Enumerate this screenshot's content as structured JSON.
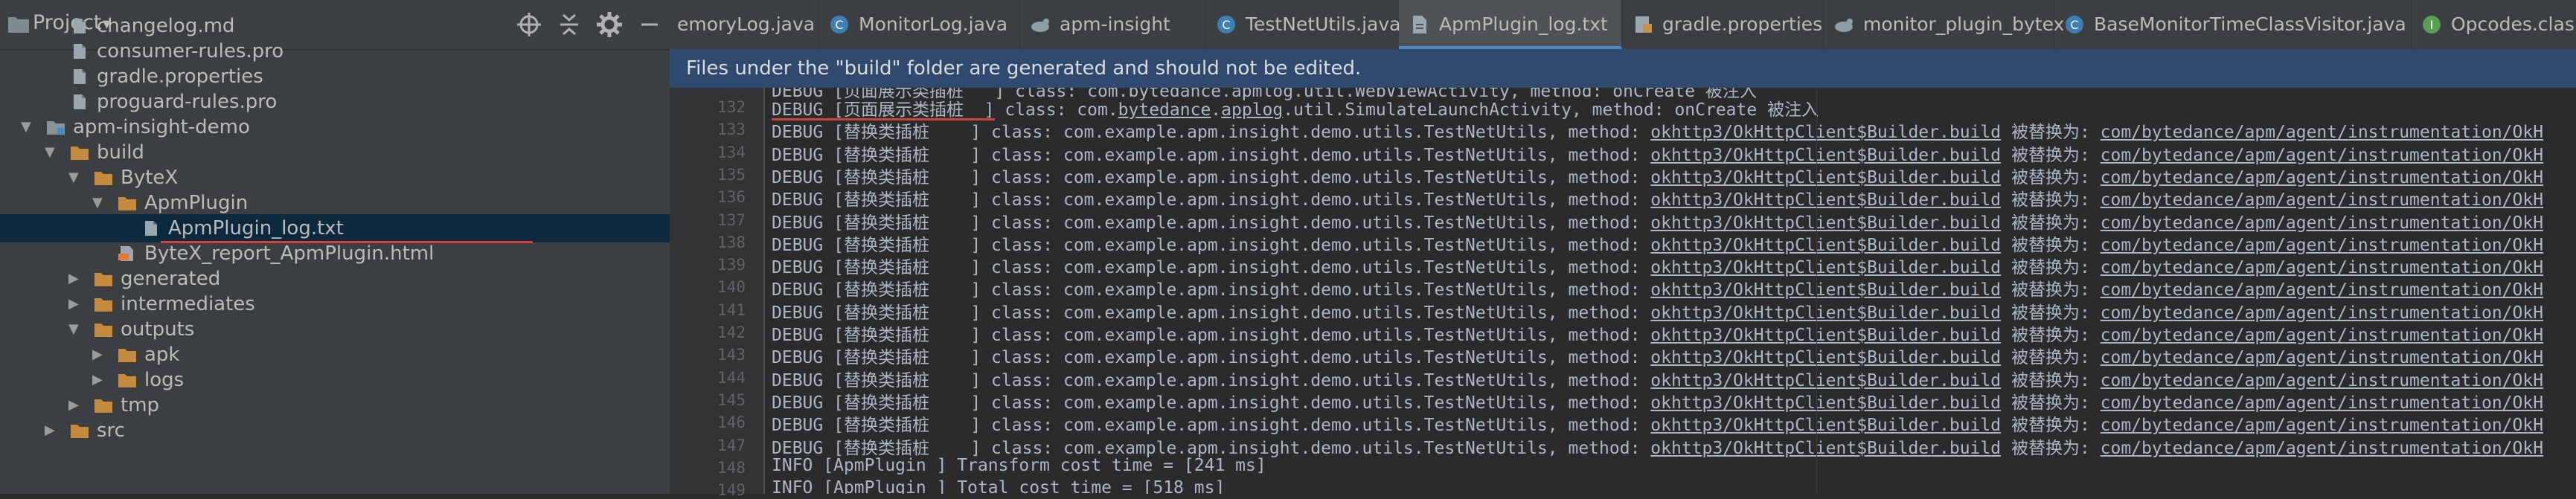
{
  "project_panel": {
    "title": "Project",
    "tree": [
      {
        "label": "changelog.md",
        "indent": 1,
        "icon": "file",
        "arrow": ""
      },
      {
        "label": "consumer-rules.pro",
        "indent": 1,
        "icon": "file",
        "arrow": ""
      },
      {
        "label": "gradle.properties",
        "indent": 1,
        "icon": "file",
        "arrow": ""
      },
      {
        "label": "proguard-rules.pro",
        "indent": 1,
        "icon": "file",
        "arrow": ""
      },
      {
        "label": "apm-insight-demo",
        "indent": 0,
        "icon": "module",
        "arrow": "down"
      },
      {
        "label": "build",
        "indent": 1,
        "icon": "folder",
        "arrow": "down"
      },
      {
        "label": "ByteX",
        "indent": 2,
        "icon": "folder",
        "arrow": "down"
      },
      {
        "label": "ApmPlugin",
        "indent": 3,
        "icon": "folder",
        "arrow": "down"
      },
      {
        "label": "ApmPlugin_log.txt",
        "indent": 4,
        "icon": "file",
        "arrow": "",
        "selected": true
      },
      {
        "label": "ByteX_report_ApmPlugin.html",
        "indent": 3,
        "icon": "html",
        "arrow": ""
      },
      {
        "label": "generated",
        "indent": 2,
        "icon": "folder",
        "arrow": "right"
      },
      {
        "label": "intermediates",
        "indent": 2,
        "icon": "folder",
        "arrow": "right"
      },
      {
        "label": "outputs",
        "indent": 2,
        "icon": "folder",
        "arrow": "down"
      },
      {
        "label": "apk",
        "indent": 3,
        "icon": "folder",
        "arrow": "right"
      },
      {
        "label": "logs",
        "indent": 3,
        "icon": "folder",
        "arrow": "right"
      },
      {
        "label": "tmp",
        "indent": 2,
        "icon": "folder",
        "arrow": "right"
      },
      {
        "label": "src",
        "indent": 1,
        "icon": "folder",
        "arrow": "right"
      }
    ]
  },
  "tabs": [
    {
      "label": "emoryLog.java",
      "icon": "",
      "active": false
    },
    {
      "label": "MonitorLog.java",
      "icon": "class",
      "active": false
    },
    {
      "label": "apm-insight",
      "icon": "gradle",
      "active": false
    },
    {
      "label": "TestNetUtils.java",
      "icon": "class",
      "active": false
    },
    {
      "label": "ApmPlugin_log.txt",
      "icon": "text",
      "active": true
    },
    {
      "label": "gradle.properties",
      "icon": "props",
      "active": false
    },
    {
      "label": "monitor_plugin_bytex",
      "icon": "gradle",
      "active": false
    },
    {
      "label": "BaseMonitorTimeClassVisitor.java",
      "icon": "class",
      "active": false
    },
    {
      "label": "Opcodes.clas",
      "icon": "interface",
      "active": false
    }
  ],
  "banner": {
    "text": "Files under the \"build\" folder are generated and should not be edited."
  },
  "editor": {
    "line_numbers": [
      "132",
      "133",
      "134",
      "135",
      "136",
      "137",
      "138",
      "139",
      "140",
      "141",
      "142",
      "143",
      "144",
      "145",
      "146",
      "147",
      "148",
      "149"
    ],
    "top_partial_line": "DEBUG [页面展示类插桩   ] class: com.bytedance.apmlog.util.WebViewActivity, method: onCreate 被注入",
    "lines": [
      {
        "level": "DEBUG",
        "tag": "[页面展示类插桩  ]",
        "p1": " class: com.",
        "u1": "bytedance",
        "p2": ".",
        "u2": "applog",
        "p3": ".util.SimulateLaunchActivity, method: onCreate 被注入",
        "u3": "",
        "p4": "",
        "u4": "",
        "p5": ""
      },
      {
        "level": "DEBUG",
        "tag": "[替换类插桩    ]",
        "p1": " class: com.example.apm.insight.demo.utils.TestNetUtils, method: ",
        "u1": "okhttp3/OkHttpClient$Builder.build",
        "p2": " 被替换为: ",
        "u2": "com/bytedance/apm/agent/instrumentation/OkH",
        "p3": "",
        "u3": "",
        "p4": "",
        "u4": "",
        "p5": ""
      },
      {
        "level": "DEBUG",
        "tag": "[替换类插桩    ]",
        "p1": " class: com.example.apm.insight.demo.utils.TestNetUtils, method: ",
        "u1": "okhttp3/OkHttpClient$Builder.build",
        "p2": " 被替换为: ",
        "u2": "com/bytedance/apm/agent/instrumentation/OkH",
        "p3": "",
        "u3": "",
        "p4": "",
        "u4": "",
        "p5": ""
      },
      {
        "level": "DEBUG",
        "tag": "[替换类插桩    ]",
        "p1": " class: com.example.apm.insight.demo.utils.TestNetUtils, method: ",
        "u1": "okhttp3/OkHttpClient$Builder.build",
        "p2": " 被替换为: ",
        "u2": "com/bytedance/apm/agent/instrumentation/OkH",
        "p3": "",
        "u3": "",
        "p4": "",
        "u4": "",
        "p5": ""
      },
      {
        "level": "DEBUG",
        "tag": "[替换类插桩    ]",
        "p1": " class: com.example.apm.insight.demo.utils.TestNetUtils, method: ",
        "u1": "okhttp3/OkHttpClient$Builder.build",
        "p2": " 被替换为: ",
        "u2": "com/bytedance/apm/agent/instrumentation/OkH",
        "p3": "",
        "u3": "",
        "p4": "",
        "u4": "",
        "p5": ""
      },
      {
        "level": "DEBUG",
        "tag": "[替换类插桩    ]",
        "p1": " class: com.example.apm.insight.demo.utils.TestNetUtils, method: ",
        "u1": "okhttp3/OkHttpClient$Builder.build",
        "p2": " 被替换为: ",
        "u2": "com/bytedance/apm/agent/instrumentation/OkH",
        "p3": "",
        "u3": "",
        "p4": "",
        "u4": "",
        "p5": ""
      },
      {
        "level": "DEBUG",
        "tag": "[替换类插桩    ]",
        "p1": " class: com.example.apm.insight.demo.utils.TestNetUtils, method: ",
        "u1": "okhttp3/OkHttpClient$Builder.build",
        "p2": " 被替换为: ",
        "u2": "com/bytedance/apm/agent/instrumentation/OkH",
        "p3": "",
        "u3": "",
        "p4": "",
        "u4": "",
        "p5": ""
      },
      {
        "level": "DEBUG",
        "tag": "[替换类插桩    ]",
        "p1": " class: com.example.apm.insight.demo.utils.TestNetUtils, method: ",
        "u1": "okhttp3/OkHttpClient$Builder.build",
        "p2": " 被替换为: ",
        "u2": "com/bytedance/apm/agent/instrumentation/OkH",
        "p3": "",
        "u3": "",
        "p4": "",
        "u4": "",
        "p5": ""
      },
      {
        "level": "DEBUG",
        "tag": "[替换类插桩    ]",
        "p1": " class: com.example.apm.insight.demo.utils.TestNetUtils, method: ",
        "u1": "okhttp3/OkHttpClient$Builder.build",
        "p2": " 被替换为: ",
        "u2": "com/bytedance/apm/agent/instrumentation/OkH",
        "p3": "",
        "u3": "",
        "p4": "",
        "u4": "",
        "p5": ""
      },
      {
        "level": "DEBUG",
        "tag": "[替换类插桩    ]",
        "p1": " class: com.example.apm.insight.demo.utils.TestNetUtils, method: ",
        "u1": "okhttp3/OkHttpClient$Builder.build",
        "p2": " 被替换为: ",
        "u2": "com/bytedance/apm/agent/instrumentation/OkH",
        "p3": "",
        "u3": "",
        "p4": "",
        "u4": "",
        "p5": ""
      },
      {
        "level": "DEBUG",
        "tag": "[替换类插桩    ]",
        "p1": " class: com.example.apm.insight.demo.utils.TestNetUtils, method: ",
        "u1": "okhttp3/OkHttpClient$Builder.build",
        "p2": " 被替换为: ",
        "u2": "com/bytedance/apm/agent/instrumentation/OkH",
        "p3": "",
        "u3": "",
        "p4": "",
        "u4": "",
        "p5": ""
      },
      {
        "level": "DEBUG",
        "tag": "[替换类插桩    ]",
        "p1": " class: com.example.apm.insight.demo.utils.TestNetUtils, method: ",
        "u1": "okhttp3/OkHttpClient$Builder.build",
        "p2": " 被替换为: ",
        "u2": "com/bytedance/apm/agent/instrumentation/OkH",
        "p3": "",
        "u3": "",
        "p4": "",
        "u4": "",
        "p5": ""
      },
      {
        "level": "DEBUG",
        "tag": "[替换类插桩    ]",
        "p1": " class: com.example.apm.insight.demo.utils.TestNetUtils, method: ",
        "u1": "okhttp3/OkHttpClient$Builder.build",
        "p2": " 被替换为: ",
        "u2": "com/bytedance/apm/agent/instrumentation/OkH",
        "p3": "",
        "u3": "",
        "p4": "",
        "u4": "",
        "p5": ""
      },
      {
        "level": "DEBUG",
        "tag": "[替换类插桩    ]",
        "p1": " class: com.example.apm.insight.demo.utils.TestNetUtils, method: ",
        "u1": "okhttp3/OkHttpClient$Builder.build",
        "p2": " 被替换为: ",
        "u2": "com/bytedance/apm/agent/instrumentation/OkH",
        "p3": "",
        "u3": "",
        "p4": "",
        "u4": "",
        "p5": ""
      },
      {
        "level": "DEBUG",
        "tag": "[替换类插桩    ]",
        "p1": " class: com.example.apm.insight.demo.utils.TestNetUtils, method: ",
        "u1": "okhttp3/OkHttpClient$Builder.build",
        "p2": " 被替换为: ",
        "u2": "com/bytedance/apm/agent/instrumentation/OkH",
        "p3": "",
        "u3": "",
        "p4": "",
        "u4": "",
        "p5": ""
      },
      {
        "level": "DEBUG",
        "tag": "[替换类插桩    ]",
        "p1": " class: com.example.apm.insight.demo.utils.TestNetUtils, method: ",
        "u1": "okhttp3/OkHttpClient$Builder.build",
        "p2": " 被替换为: ",
        "u2": "com/bytedance/apm/agent/instrumentation/OkH",
        "p3": "",
        "u3": "",
        "p4": "",
        "u4": "",
        "p5": ""
      },
      {
        "level": "INFO",
        "tag": "[ApmPlugin ]",
        "p1": " Transform cost time = [241 ms]",
        "u1": "",
        "p2": "",
        "u2": "",
        "p3": "",
        "u3": "",
        "p4": "",
        "u4": "",
        "p5": ""
      },
      {
        "level": "INFO",
        "tag": "[ApmPlugin ]",
        "p1": " Total cost time = [518 ms]",
        "u1": "",
        "p2": "",
        "u2": "",
        "p3": "",
        "u3": "",
        "p4": "",
        "u4": "",
        "p5": ""
      }
    ]
  },
  "colors": {
    "panel_bg": "#3c3f41",
    "editor_bg": "#2b2b2b",
    "selected_row": "#0d293e",
    "banner_bg": "#2f4a6e",
    "active_tab_underline": "#4a88c7",
    "annotation_red": "#d0433d",
    "folder": "#c68a3c"
  }
}
